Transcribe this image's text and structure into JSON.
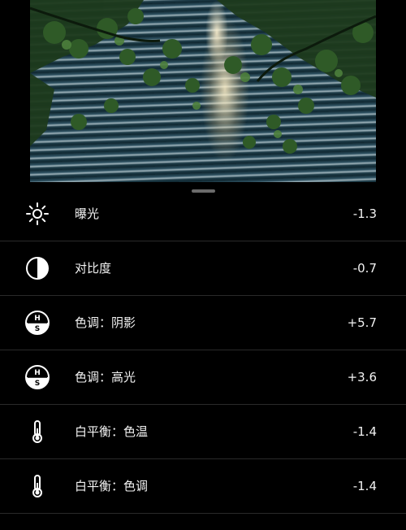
{
  "photo": {
    "description": "photo-preview"
  },
  "adjustments": [
    {
      "icon": "sun-icon",
      "label": "曝光",
      "value": "-1.3"
    },
    {
      "icon": "contrast-icon",
      "label": "对比度",
      "value": "-0.7"
    },
    {
      "icon": "hs-icon",
      "label": "色调：阴影",
      "value": "+5.7"
    },
    {
      "icon": "hs-icon",
      "label": "色调：高光",
      "value": "+3.6"
    },
    {
      "icon": "thermometer-icon",
      "label": "白平衡：色温",
      "value": "-1.4"
    },
    {
      "icon": "thermometer-icon",
      "label": "白平衡：色调",
      "value": "-1.4"
    }
  ]
}
